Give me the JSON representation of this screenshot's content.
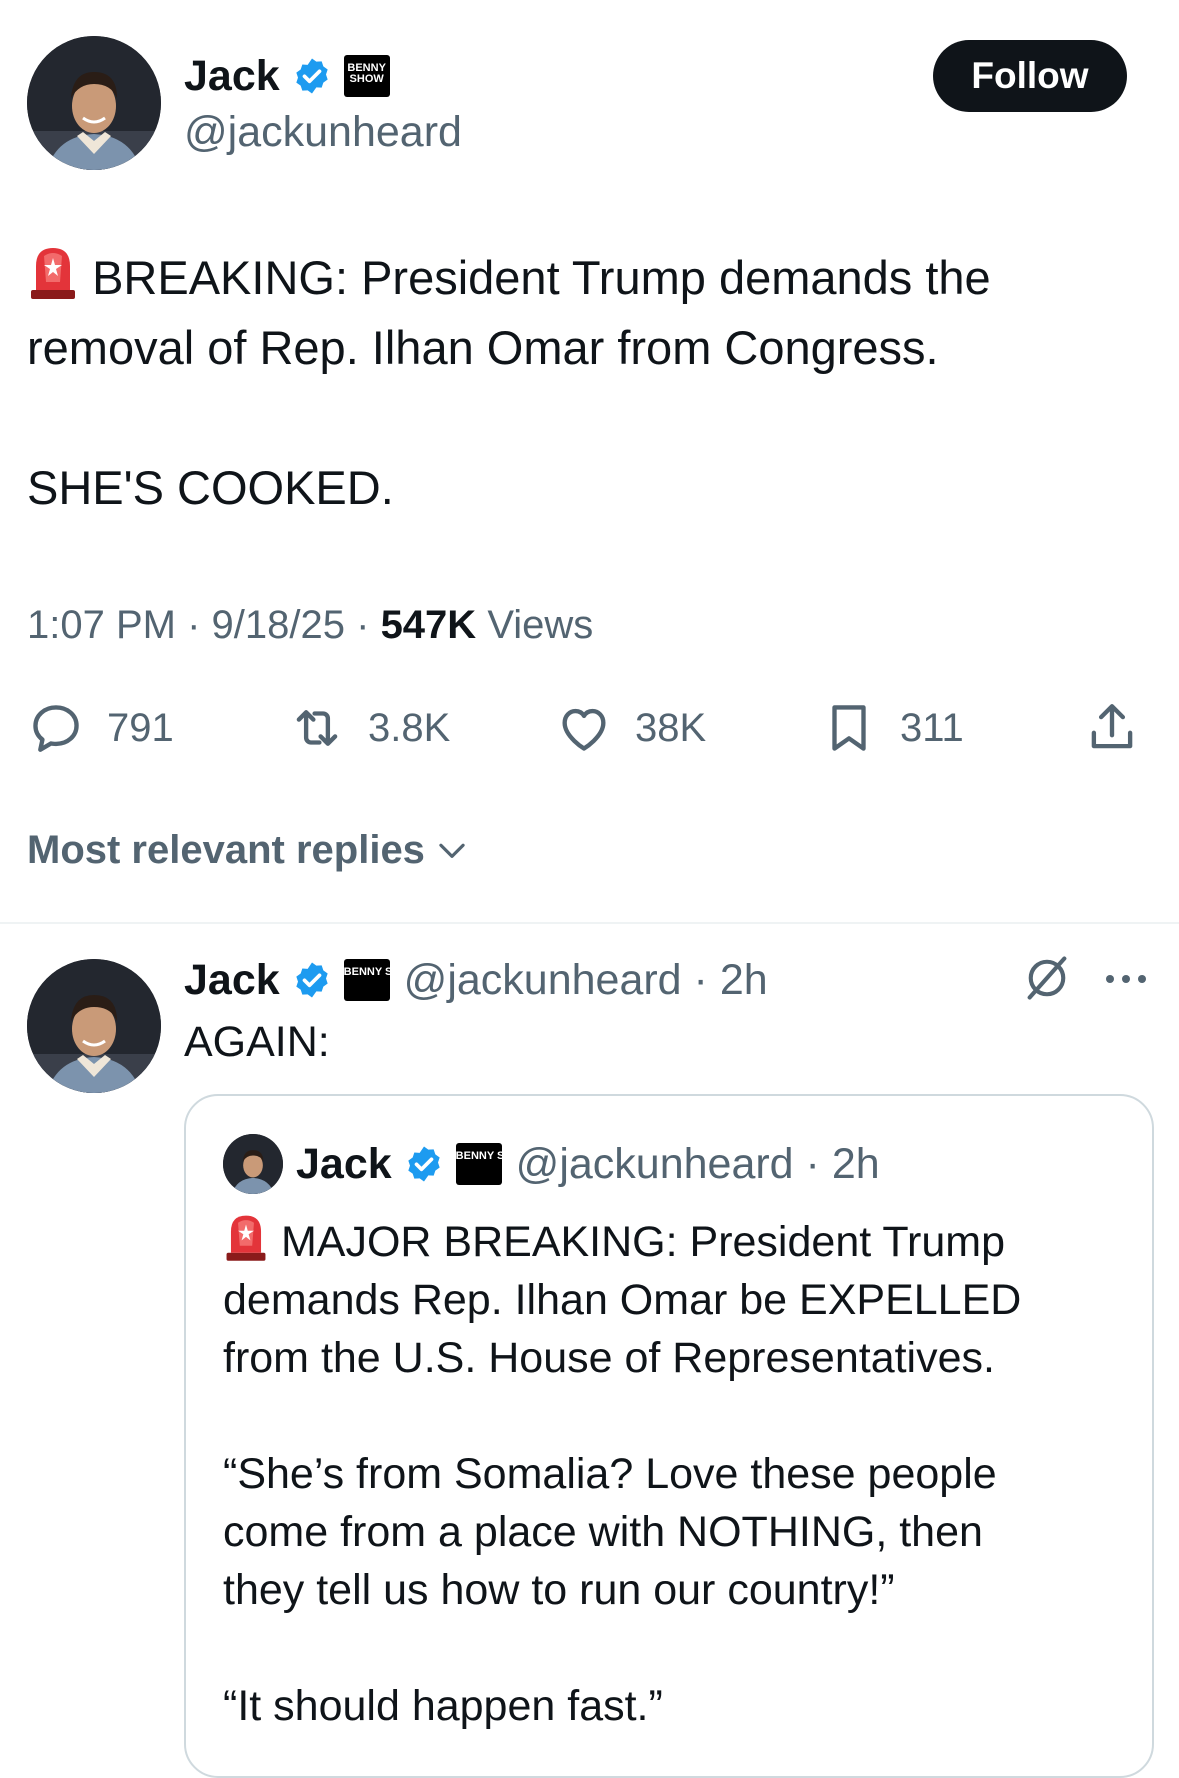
{
  "main_tweet": {
    "author_name": "Jack",
    "author_handle": "@jackunheard",
    "badge_text": "BENNY SHOW",
    "follow_label": "Follow",
    "text_line1": "BREAKING: President Trump demands the",
    "text_line2": "removal of Rep. Ilhan Omar from Congress.",
    "text_line3": "SHE'S COOKED.",
    "time": "1:07 PM",
    "date": "9/18/25",
    "views_count": "547K",
    "views_label": "Views",
    "replies": "791",
    "reposts": "3.8K",
    "likes": "38K",
    "bookmarks": "311"
  },
  "replies_filter": {
    "label": "Most relevant replies"
  },
  "reply": {
    "author_name": "Jack",
    "author_handle": "@jackunheard",
    "time_ago": "2h",
    "text": "AGAIN:",
    "quote": {
      "author_name": "Jack",
      "author_handle": "@jackunheard",
      "time_ago": "2h",
      "line1": "MAJOR BREAKING: President Trump",
      "line2": "demands Rep. Ilhan Omar be EXPELLED",
      "line3": "from the U.S. House of Representatives.",
      "line4": "“She’s from Somalia? Love these people",
      "line5": "come from a place with NOTHING, then",
      "line6": "they tell us how to run our country!”",
      "line7": "“It should happen fast.”"
    }
  },
  "icons": {
    "verified": "verified-badge-icon",
    "reply": "reply-icon",
    "repost": "repost-icon",
    "like": "heart-icon",
    "bookmark": "bookmark-icon",
    "share": "share-icon",
    "grok": "grok-icon",
    "more": "more-icon",
    "chevron": "chevron-down-icon",
    "siren": "siren-emoji"
  },
  "colors": {
    "verified_blue": "#1d9bf0",
    "follow_bg": "#0f1419",
    "secondary_text": "#536471"
  }
}
